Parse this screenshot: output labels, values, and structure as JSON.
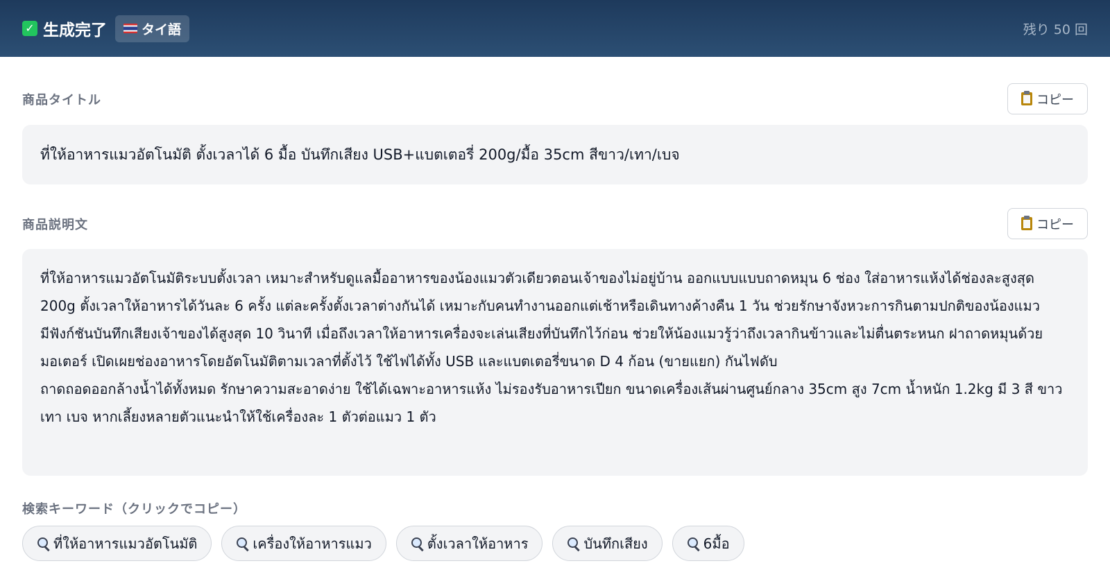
{
  "header": {
    "status_label": "生成完了",
    "language_label": "タイ語",
    "remaining_label": "残り 50 回"
  },
  "title_section": {
    "label": "商品タイトル",
    "copy_label": "コピー",
    "text": "ที่ให้อาหารแมวอัตโนมัติ ตั้งเวลาได้ 6 มื้อ บันทึกเสียง USB+แบตเตอรี่ 200g/มื้อ 35cm สีขาว/เทา/เบจ"
  },
  "description_section": {
    "label": "商品説明文",
    "copy_label": "コピー",
    "paragraphs": [
      "ที่ให้อาหารแมวอัตโนมัติระบบตั้งเวลา เหมาะสำหรับดูแลมื้ออาหารของน้องแมวตัวเดียวตอนเจ้าของไม่อยู่บ้าน ออกแบบแบบถาดหมุน 6 ช่อง ใส่อาหารแห้งได้ช่องละสูงสุด 200g ตั้งเวลาให้อาหารได้วันละ 6 ครั้ง แต่ละครั้งตั้งเวลาต่างกันได้ เหมาะกับคนทำงานออกแต่เช้าหรือเดินทางค้างคืน 1 วัน ช่วยรักษาจังหวะการกินตามปกติของน้องแมว",
      "มีฟังก์ชันบันทึกเสียงเจ้าของได้สูงสุด 10 วินาที เมื่อถึงเวลาให้อาหารเครื่องจะเล่นเสียงที่บันทึกไว้ก่อน ช่วยให้น้องแมวรู้ว่าถึงเวลากินข้าวและไม่ตื่นตระหนก ฝาถาดหมุนด้วยมอเตอร์ เปิดเผยช่องอาหารโดยอัตโนมัติตามเวลาที่ตั้งไว้ ใช้ไฟได้ทั้ง USB และแบตเตอรี่ขนาด D 4 ก้อน (ขายแยก) กันไฟดับ",
      "ถาดถอดออกล้างน้ำได้ทั้งหมด รักษาความสะอาดง่าย ใช้ได้เฉพาะอาหารแห้ง ไม่รองรับอาหารเปียก ขนาดเครื่องเส้นผ่านศูนย์กลาง 35cm สูง 7cm น้ำหนัก 1.2kg มี 3 สี ขาว เทา เบจ หากเลี้ยงหลายตัวแนะนำให้ใช้เครื่องละ 1 ตัวต่อแมว 1 ตัว"
    ]
  },
  "keywords_section": {
    "label": "検索キーワード（クリックでコピー）",
    "items": [
      "ที่ให้อาหารแมวอัตโนมัติ",
      "เครื่องให้อาหารแมว",
      "ตั้งเวลาให้อาหาร",
      "บันทึกเสียง",
      "6มื้อ"
    ]
  },
  "colors": {
    "header_bg": "#1e3a5c",
    "panel_bg": "#f3f4f6",
    "success": "#22c55e"
  },
  "icons": [
    "check-icon",
    "thai-flag-icon",
    "clipboard-icon",
    "search-icon"
  ]
}
